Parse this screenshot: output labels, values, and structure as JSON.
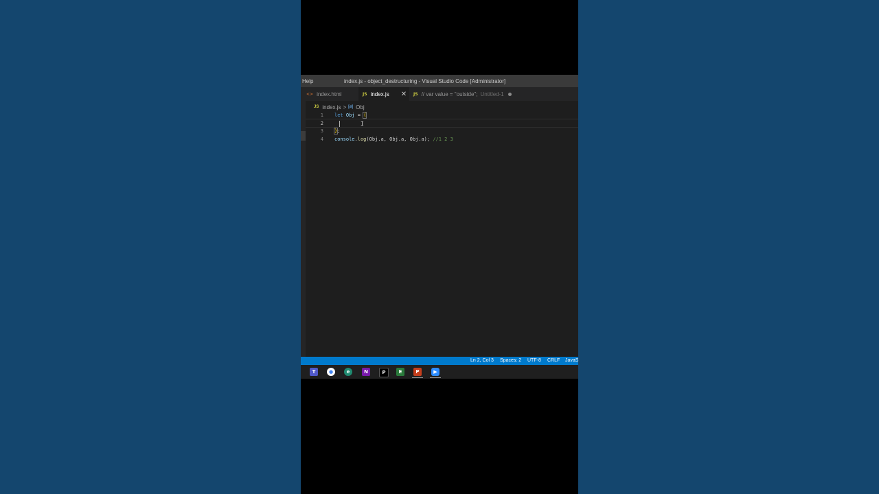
{
  "window": {
    "menu": "Help",
    "title": "index.js - object_destructuring - Visual Studio Code [Administrator]"
  },
  "tabs": [
    {
      "icon": "<>",
      "label": "index.html",
      "active": false
    },
    {
      "icon": "JS",
      "label": "index.js",
      "active": true,
      "close": "✕"
    },
    {
      "icon": "JS",
      "label": "// var value = \"outside\";",
      "sub": "Untitled-1",
      "dirty": true
    }
  ],
  "breadcrumb": {
    "file_icon": "JS",
    "file": "index.js",
    "separator": ">",
    "symbol_icon": "[ø]",
    "symbol": "Obj"
  },
  "editor": {
    "lines": [
      {
        "num": "1"
      },
      {
        "num": "2"
      },
      {
        "num": "3"
      },
      {
        "num": "4"
      }
    ],
    "tokens": {
      "let": "let",
      "obj": "Obj",
      "eq": " = ",
      "open_brace": "{",
      "close_brace": "}",
      "semicolon": ";",
      "console": "console",
      "log": "log",
      "args": "(Obj.a, Obj.a, Obj.a); ",
      "comment": "//1 2 3"
    },
    "cursor_line": 2
  },
  "statusbar": {
    "position": "Ln 2, Col 3",
    "spaces": "Spaces: 2",
    "encoding": "UTF-8",
    "eol": "CRLF",
    "language": "JavaS"
  },
  "taskbar": {
    "apps": [
      "teams-icon",
      "chrome-icon",
      "edge-icon",
      "onenote-icon",
      "pycharm-icon",
      "explorer-icon",
      "powerpoint-icon",
      "zoom-icon"
    ]
  },
  "colors": {
    "background": "#14466e",
    "editor": "#1e1e1e",
    "statusbar": "#007acc"
  }
}
